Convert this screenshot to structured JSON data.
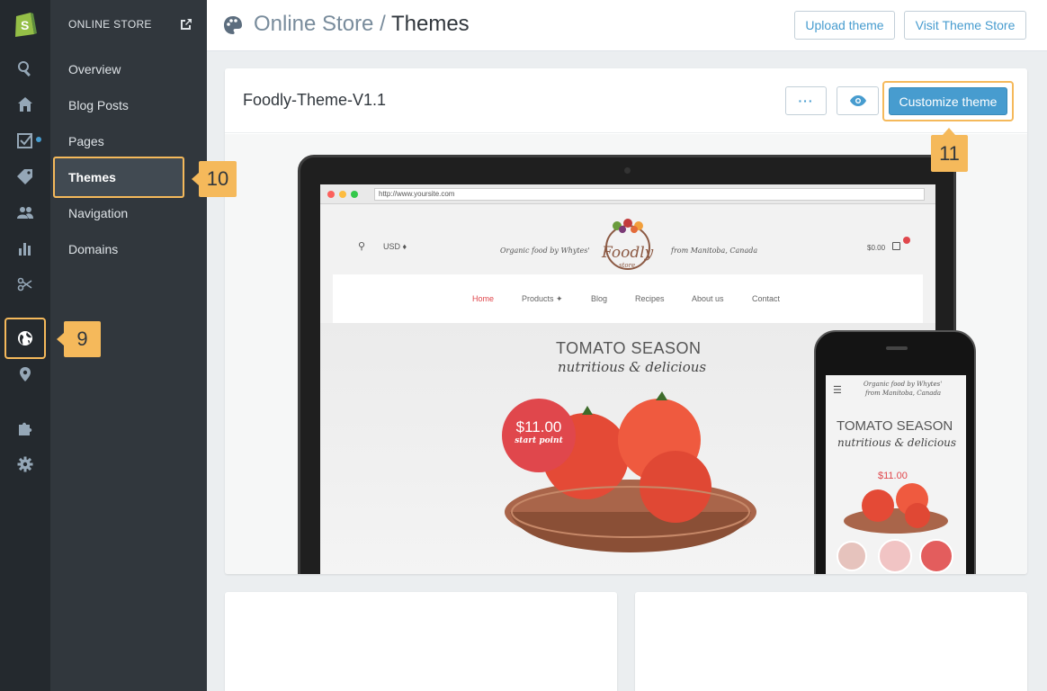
{
  "sidebar_rail": {
    "items": [
      "shopify-logo",
      "search",
      "home",
      "orders",
      "products",
      "customers",
      "reports",
      "discounts",
      "online-store",
      "location",
      "apps",
      "settings"
    ]
  },
  "subnav": {
    "header": "ONLINE STORE",
    "items": [
      {
        "label": "Overview"
      },
      {
        "label": "Blog Posts"
      },
      {
        "label": "Pages"
      },
      {
        "label": "Themes"
      },
      {
        "label": "Navigation"
      },
      {
        "label": "Domains"
      }
    ]
  },
  "callouts": {
    "c9": "9",
    "c10": "10",
    "c11": "11"
  },
  "header": {
    "breadcrumb_parent": "Online Store",
    "separator": " / ",
    "breadcrumb_current": "Themes",
    "upload_label": "Upload theme",
    "visit_label": "Visit Theme Store"
  },
  "theme_card": {
    "name": "Foodly-Theme-V1.1",
    "more_label": "···",
    "customize_label": "Customize theme"
  },
  "preview": {
    "url": "http://www.yoursite.com",
    "currency": "USD ♦",
    "tagline_left": "Organic food by Whytes'",
    "tagline_right": "from Manitoba, Canada",
    "logo_text": "Foodly",
    "logo_sub": "store",
    "cart": "$0.00",
    "menu": [
      "Home",
      "Products ✦",
      "Blog",
      "Recipes",
      "About us",
      "Contact"
    ],
    "hero_title": "TOMATO SEASON",
    "hero_sub": "nutritious & delicious",
    "price": "$11.00",
    "price_note": "start point",
    "phone_tagline1": "Organic food by Whytes'",
    "phone_tagline2": "from Manitoba, Canada",
    "phone_price": "$11.00"
  },
  "colors": {
    "accent": "#479ccf",
    "highlight": "#f5b95b",
    "rail": "#24292e",
    "subnav": "#31373d",
    "sale": "#e0474c"
  }
}
